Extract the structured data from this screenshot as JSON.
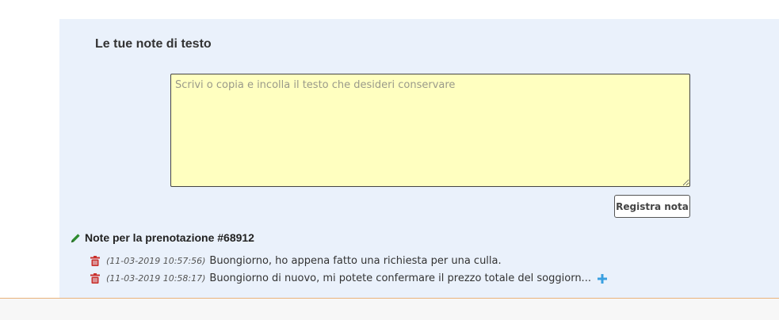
{
  "notes_panel": {
    "title": "Le tue note di testo",
    "textarea_placeholder": "Scrivi o copia e incolla il testo che desideri conservare",
    "textarea_value": "",
    "save_label": "Registra nota"
  },
  "booking_notes": {
    "heading": "Note per la prenotazione #68912",
    "items": [
      {
        "timestamp": "(11-03-2019 10:57:56)",
        "text": "Buongiorno, ho appena fatto una richiesta per una culla.",
        "expandable": false
      },
      {
        "timestamp": "(11-03-2019 10:58:17)",
        "text": "Buongiorno di nuovo, mi potete confermare il prezzo totale del soggiorn...",
        "expandable": true
      }
    ]
  },
  "colors": {
    "panel_bg": "#eaf1fb",
    "textarea_bg": "#ffffc0",
    "trash": "#c9302c",
    "pencil": "#2e8b2e",
    "plus": "#3aa0e0",
    "footer_border": "#e8b27a"
  }
}
